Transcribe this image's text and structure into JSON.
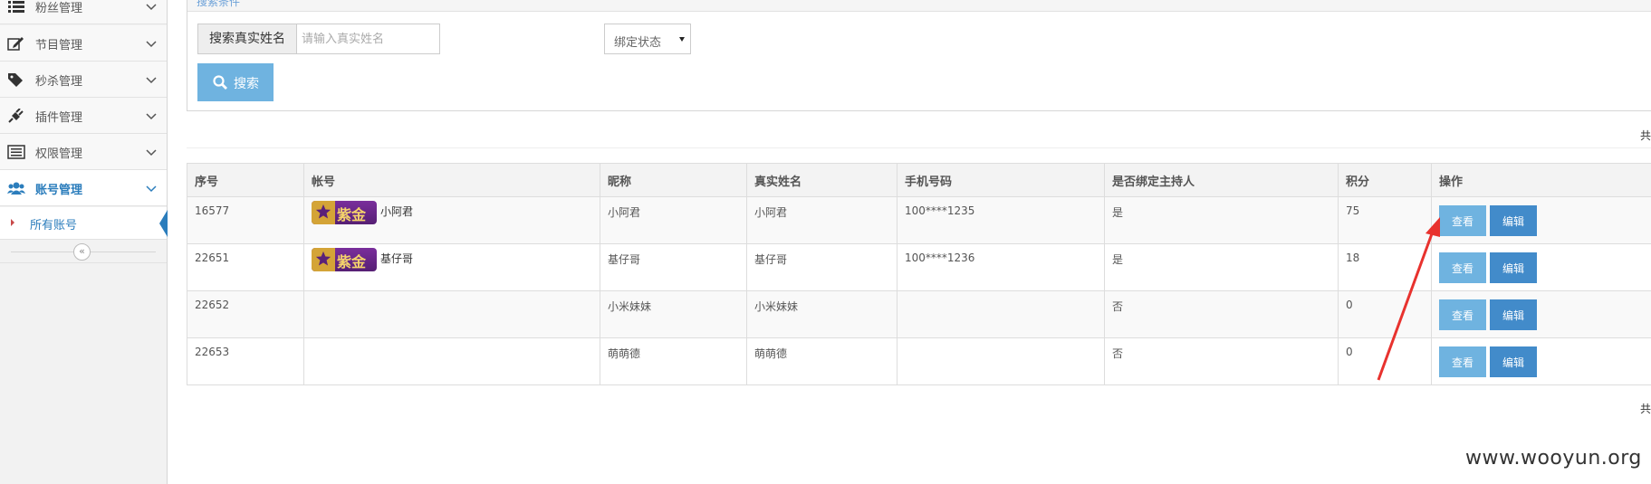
{
  "sidebar": {
    "items": [
      {
        "label": "粉丝管理",
        "icon": "list-icon"
      },
      {
        "label": "节目管理",
        "icon": "edit-icon"
      },
      {
        "label": "秒杀管理",
        "icon": "tag-icon"
      },
      {
        "label": "插件管理",
        "icon": "plug-icon"
      },
      {
        "label": "权限管理",
        "icon": "list-alt-icon"
      },
      {
        "label": "账号管理",
        "icon": "users-icon",
        "active": true
      }
    ],
    "sub_item": "所有账号"
  },
  "search": {
    "panel_title": "搜索条件",
    "name_label": "搜索真实姓名",
    "name_placeholder": "请输入真实姓名",
    "status_select": "绑定状态",
    "button": "搜索"
  },
  "total_label": "共",
  "table": {
    "headers": [
      "序号",
      "帐号",
      "昵称",
      "真实姓名",
      "手机号码",
      "是否绑定主持人",
      "积分",
      "操作"
    ],
    "rows": [
      {
        "id": "16577",
        "badge": "紫金",
        "account": "小阿君",
        "nickname": "小阿君",
        "real_name": "小阿君",
        "phone": "100****1235",
        "bound": "是",
        "points": "75"
      },
      {
        "id": "22651",
        "badge": "紫金",
        "account": "基仔哥",
        "nickname": "基仔哥",
        "real_name": "基仔哥",
        "phone": "100****1236",
        "bound": "是",
        "points": "18"
      },
      {
        "id": "22652",
        "badge": "",
        "account": "",
        "nickname": "小米妹妹",
        "real_name": "小米妹妹",
        "phone": "",
        "bound": "否",
        "points": "0"
      },
      {
        "id": "22653",
        "badge": "",
        "account": "",
        "nickname": "萌萌德",
        "real_name": "萌萌德",
        "phone": "",
        "bound": "否",
        "points": "0"
      }
    ],
    "view_label": "查看",
    "edit_label": "编辑"
  },
  "watermark": "www.wooyun.org",
  "colors": {
    "accent": "#2b7dbc",
    "view_button": "#6fb3e0",
    "edit_button": "#428bca",
    "annotation_arrow": "#e8322e",
    "badge_purple": "#6a2889",
    "badge_gold": "#f4d36b"
  }
}
